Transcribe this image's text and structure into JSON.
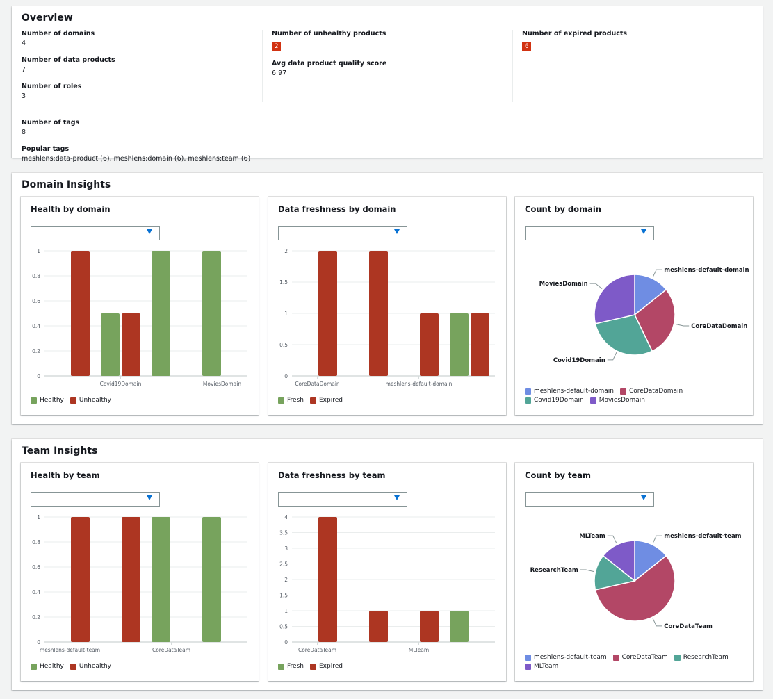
{
  "overview": {
    "title": "Overview",
    "col1": [
      {
        "label": "Number of domains",
        "value": "4"
      },
      {
        "label": "Number of data products",
        "value": "7"
      },
      {
        "label": "Number of roles",
        "value": "3"
      }
    ],
    "tags": {
      "label": "Number of tags",
      "value": "8"
    },
    "popular": {
      "label": "Popular tags",
      "value": "meshlens:data-product (6), meshlens:domain (6), meshlens:team (6)"
    },
    "unhealthy": {
      "label": "Number of unhealthy products",
      "value": "2"
    },
    "quality": {
      "label": "Avg data product quality score",
      "value": "6.97"
    },
    "expired": {
      "label": "Number of expired products",
      "value": "6"
    },
    "badge_color": "#d13212"
  },
  "domain_section": {
    "title": "Domain Insights"
  },
  "team_section": {
    "title": "Team Insights"
  },
  "dropdown": {
    "icon": "caret-down-icon",
    "value": ""
  },
  "colors": {
    "green": "#77a35d",
    "red": "#ad3622",
    "blue": "#6f8de3",
    "crimson": "#b34766",
    "teal": "#52a597",
    "purple": "#7e5ac8"
  },
  "chart_data": [
    {
      "id": "health-domain",
      "type": "bar",
      "title": "Health by domain",
      "categories": [
        "",
        "Covid19Domain",
        "",
        "MoviesDomain"
      ],
      "yticks": [
        "0",
        "0.2",
        "0.4",
        "0.6",
        "0.8",
        "1"
      ],
      "ylim": [
        0,
        1
      ],
      "series": [
        {
          "name": "Healthy",
          "color": "#77a35d",
          "values": [
            0,
            0.5,
            1,
            1
          ]
        },
        {
          "name": "Unhealthy",
          "color": "#ad3622",
          "values": [
            1,
            0.5,
            0,
            0
          ]
        }
      ]
    },
    {
      "id": "fresh-domain",
      "type": "bar",
      "title": "Data freshness by domain",
      "categories": [
        "CoreDataDomain",
        "",
        "meshlens-default-domain",
        ""
      ],
      "yticks": [
        "0",
        "0.5",
        "1",
        "1.5",
        "2"
      ],
      "ylim": [
        0,
        2
      ],
      "series": [
        {
          "name": "Fresh",
          "color": "#77a35d",
          "values": [
            0,
            0,
            0,
            1
          ]
        },
        {
          "name": "Expired",
          "color": "#ad3622",
          "values": [
            2,
            2,
            1,
            1
          ]
        }
      ]
    },
    {
      "id": "count-domain",
      "type": "pie",
      "title": "Count by domain",
      "slices": [
        {
          "name": "meshlens-default-domain",
          "value": 1,
          "color": "#6f8de3"
        },
        {
          "name": "CoreDataDomain",
          "value": 2,
          "color": "#b34766"
        },
        {
          "name": "Covid19Domain",
          "value": 2,
          "color": "#52a597"
        },
        {
          "name": "MoviesDomain",
          "value": 2,
          "color": "#7e5ac8"
        }
      ]
    },
    {
      "id": "health-team",
      "type": "bar",
      "title": "Health by team",
      "categories": [
        "meshlens-default-team",
        "",
        "CoreDataTeam",
        ""
      ],
      "yticks": [
        "0",
        "0.2",
        "0.4",
        "0.6",
        "0.8",
        "1"
      ],
      "ylim": [
        0,
        1
      ],
      "series": [
        {
          "name": "Healthy",
          "color": "#77a35d",
          "values": [
            0,
            0,
            1,
            1
          ]
        },
        {
          "name": "Unhealthy",
          "color": "#ad3622",
          "values": [
            1,
            1,
            0,
            0
          ]
        }
      ]
    },
    {
      "id": "fresh-team",
      "type": "bar",
      "title": "Data freshness by team",
      "categories": [
        "CoreDataTeam",
        "",
        "MLTeam",
        ""
      ],
      "yticks": [
        "0",
        "0.5",
        "1",
        "1.5",
        "2",
        "2.5",
        "3",
        "3.5",
        "4"
      ],
      "ylim": [
        0,
        4
      ],
      "series": [
        {
          "name": "Fresh",
          "color": "#77a35d",
          "values": [
            0,
            0,
            0,
            1
          ]
        },
        {
          "name": "Expired",
          "color": "#ad3622",
          "values": [
            4,
            1,
            1,
            0
          ]
        }
      ]
    },
    {
      "id": "count-team",
      "type": "pie",
      "title": "Count by team",
      "slices": [
        {
          "name": "meshlens-default-team",
          "value": 1,
          "color": "#6f8de3"
        },
        {
          "name": "CoreDataTeam",
          "value": 4,
          "color": "#b34766"
        },
        {
          "name": "ResearchTeam",
          "value": 1,
          "color": "#52a597"
        },
        {
          "name": "MLTeam",
          "value": 1,
          "color": "#7e5ac8"
        }
      ]
    }
  ]
}
